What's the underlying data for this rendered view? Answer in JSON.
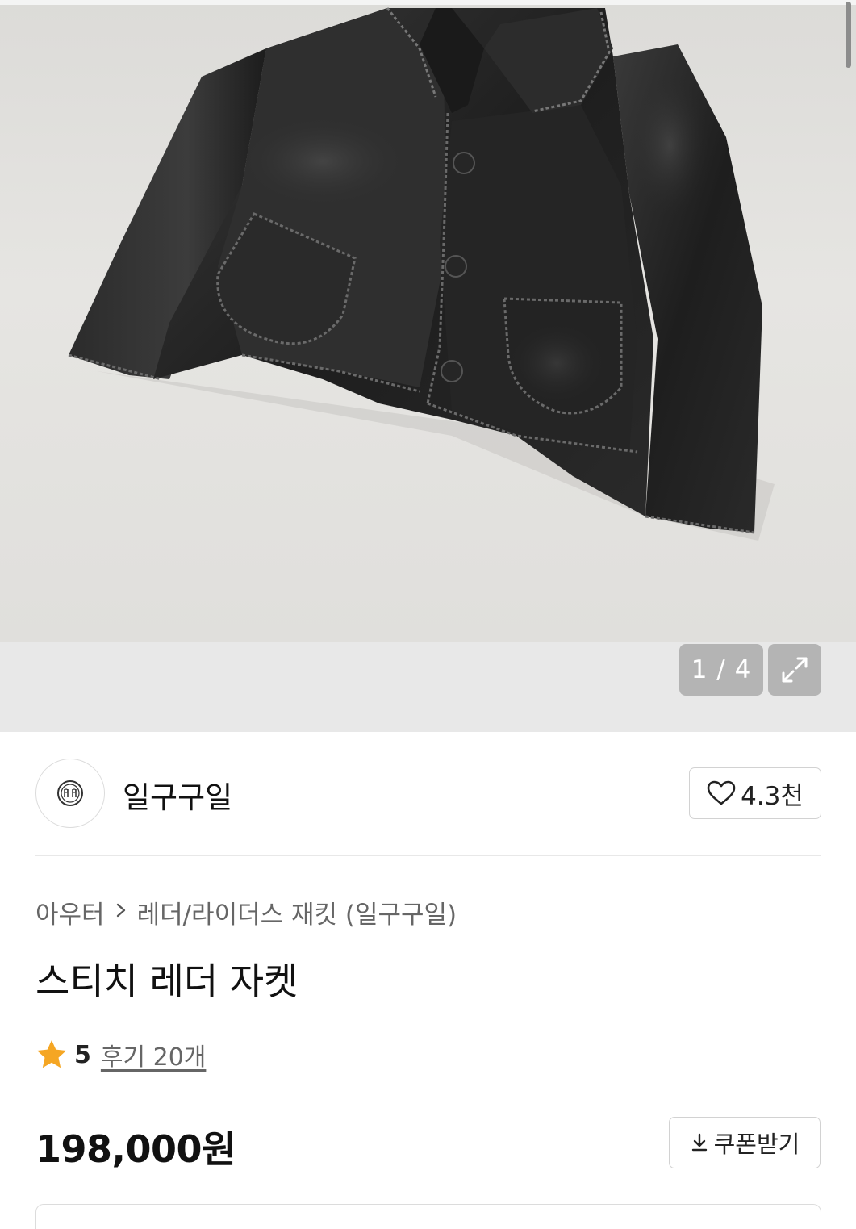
{
  "gallery": {
    "image_alt": "스티치 레더 자켓",
    "counter": "1 / 4",
    "expand_icon": "expand-icon"
  },
  "brand": {
    "name": "일구구일",
    "logo_icon": "brand-logo-icon",
    "like_icon": "heart-icon",
    "like_count": "4.3천"
  },
  "breadcrumb": {
    "category": "아우터",
    "separator_icon": "chevron-right-icon",
    "subcategory": "레더/라이더스 재킷 (일구구일)"
  },
  "product": {
    "title": "스티치 레더 자켓",
    "rating_icon": "star-icon",
    "rating": "5",
    "review_label": "후기 20개",
    "price": "198,000원"
  },
  "coupon": {
    "icon": "download-icon",
    "label": "쿠폰받기"
  },
  "colors": {
    "star": "#f5a623",
    "overlay_button": "#b4b4b4",
    "border": "#d2d2d2"
  }
}
